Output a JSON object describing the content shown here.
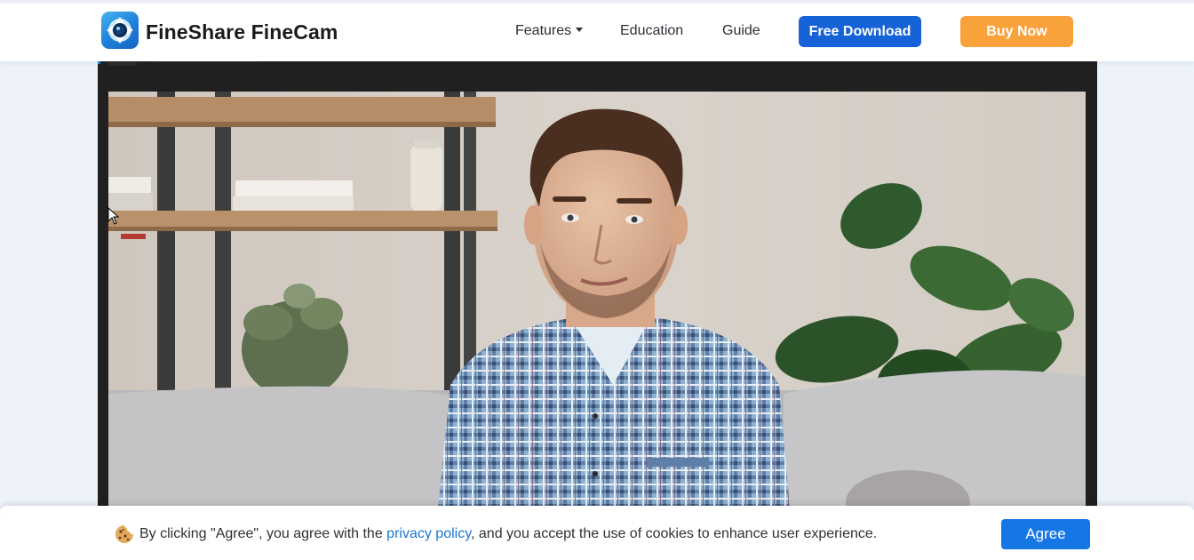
{
  "header": {
    "brand_name": "FineShare FineCam",
    "nav": {
      "features": "Features",
      "education": "Education",
      "guide": "Guide"
    },
    "free_download": "Free Download",
    "buy_now": "Buy Now"
  },
  "cookie_banner": {
    "text_before": "By clicking \"Agree\", you agree with the ",
    "link_text": "privacy policy",
    "text_after": ", and you accept the use of cookies to enhance user experience.",
    "agree_label": "Agree"
  },
  "colors": {
    "primary_blue": "#1663d8",
    "buy_orange": "#f9a13a",
    "agree_blue": "#1577e6",
    "link_blue": "#1976d2",
    "video_frame": "#202020"
  },
  "icons": {
    "logo": "finecam-logo-icon",
    "features_caret": "caret-down-icon",
    "cookie": "cookie-icon",
    "cursor": "mouse-pointer-icon"
  }
}
